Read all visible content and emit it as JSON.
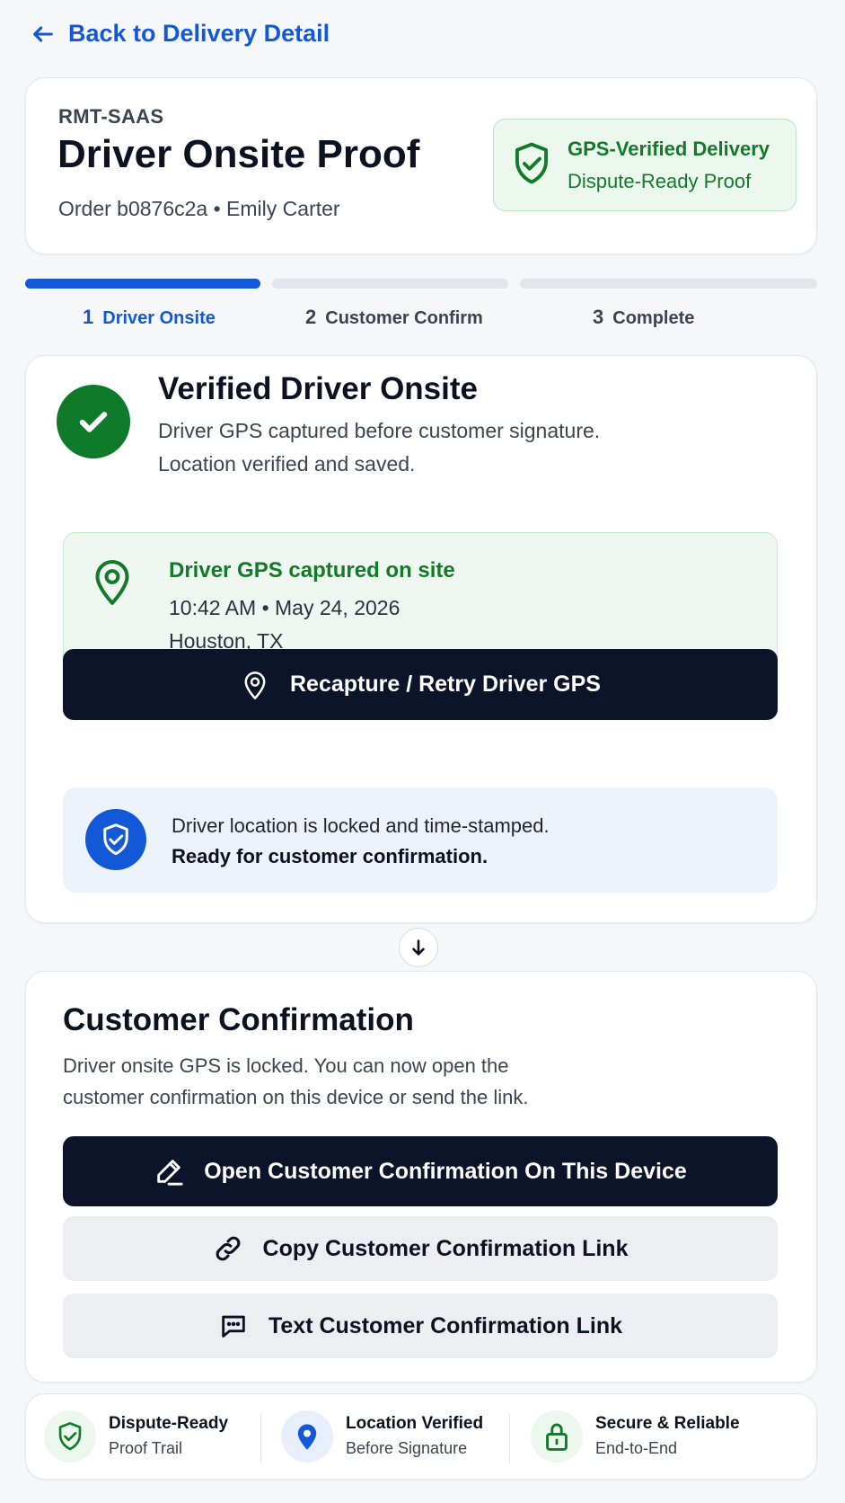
{
  "nav": {
    "back_label": "Back to Delivery Detail"
  },
  "header": {
    "org": "RMT-SAAS",
    "title": "Driver Onsite Proof",
    "subtitle": "Order b0876c2a • Emily Carter",
    "badge": {
      "title": "GPS-Verified Delivery",
      "subtitle": "Dispute-Ready Proof"
    }
  },
  "steps": [
    {
      "num": "1",
      "label": "Driver Onsite",
      "active": true
    },
    {
      "num": "2",
      "label": "Customer Confirm",
      "active": false
    },
    {
      "num": "3",
      "label": "Complete",
      "active": false
    }
  ],
  "onsite": {
    "title": "Verified Driver Onsite",
    "desc_line1": "Driver GPS captured before customer signature.",
    "desc_line2": "Location verified and saved.",
    "gps": {
      "title": "Driver GPS captured on site",
      "time": "10:42 AM • May 24, 2026",
      "location": "Houston, TX"
    },
    "retry_label": "Recapture / Retry Driver GPS",
    "lock_line1": "Driver location is locked and time-stamped.",
    "lock_line2": "Ready for customer confirmation."
  },
  "confirm": {
    "title": "Customer Confirmation",
    "desc_line1": "Driver onsite GPS is locked. You can now open the",
    "desc_line2": "customer confirmation on this device or send the link.",
    "open_label": "Open Customer Confirmation On This Device",
    "copy_label": "Copy Customer Confirmation Link",
    "text_label": "Text Customer Confirmation Link"
  },
  "footer": [
    {
      "title": "Dispute-Ready",
      "subtitle": "Proof Trail"
    },
    {
      "title": "Location Verified",
      "subtitle": "Before Signature"
    },
    {
      "title": "Secure & Reliable",
      "subtitle": "End-to-End"
    }
  ],
  "colors": {
    "accent": "#1358d6",
    "success": "#137a2a",
    "dark_button": "#0b1428"
  },
  "icons": [
    "arrow-left-icon",
    "shield-check-icon",
    "check-icon",
    "map-pin-icon",
    "pen-icon",
    "link-icon",
    "message-icon",
    "arrow-down-icon",
    "lock-icon"
  ]
}
